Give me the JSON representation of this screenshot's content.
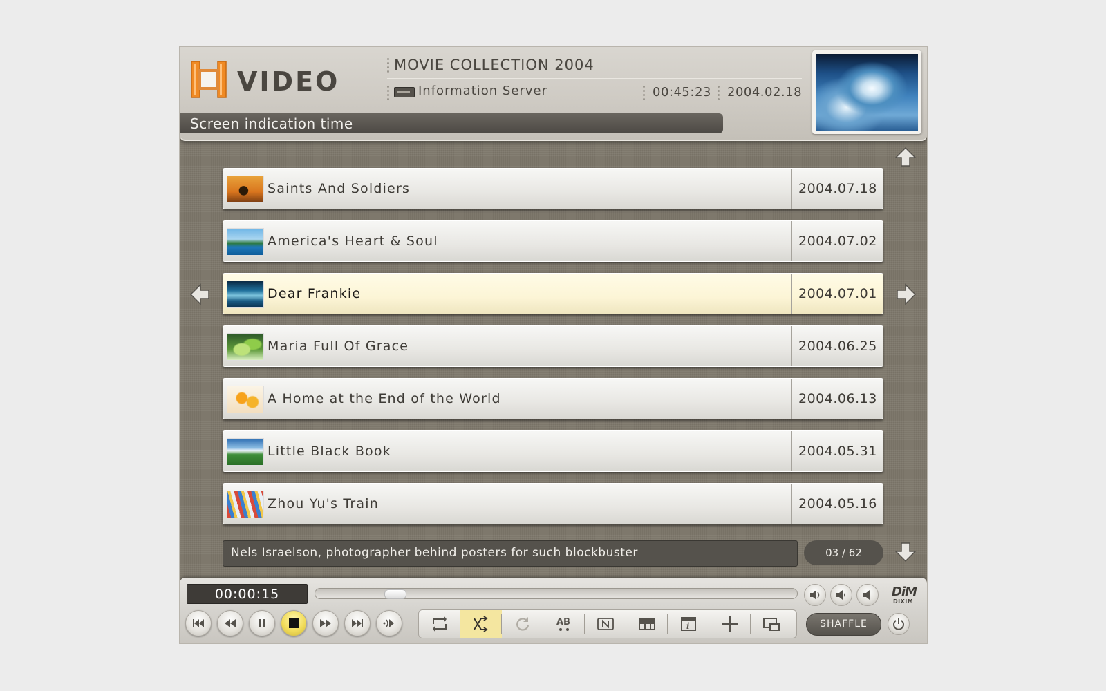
{
  "header": {
    "app_title": "VIDEO",
    "collection_title": "MOVIE COLLECTION 2004",
    "server_label": "Information Server",
    "time": "00:45:23",
    "date": "2004.02.18",
    "status_text": "Screen indication time"
  },
  "list": {
    "items": [
      {
        "title": "Saints And Soldiers",
        "date": "2004.07.18"
      },
      {
        "title": "America's Heart & Soul",
        "date": "2004.07.02"
      },
      {
        "title": "Dear Frankie",
        "date": "2004.07.01",
        "selected": true
      },
      {
        "title": "Maria Full Of Grace",
        "date": "2004.06.25"
      },
      {
        "title": "A Home at the End of the World",
        "date": "2004.06.13"
      },
      {
        "title": "Little Black Book",
        "date": "2004.05.31"
      },
      {
        "title": "Zhou Yu's Train",
        "date": "2004.05.16"
      }
    ],
    "description": "Nels Israelson, photographer behind posters for such blockbuster",
    "page_indicator": "03 / 62"
  },
  "player": {
    "elapsed": "00:00:15",
    "seek_position_fraction": 0.15,
    "shuffle_label": "SHAFFLE",
    "brand": "DiM",
    "brand_sub": "DIXIM"
  },
  "colors": {
    "accent_orange": "#f08a24",
    "selected_row": "#fcf5d6",
    "active_button": "#f1dc5a"
  }
}
